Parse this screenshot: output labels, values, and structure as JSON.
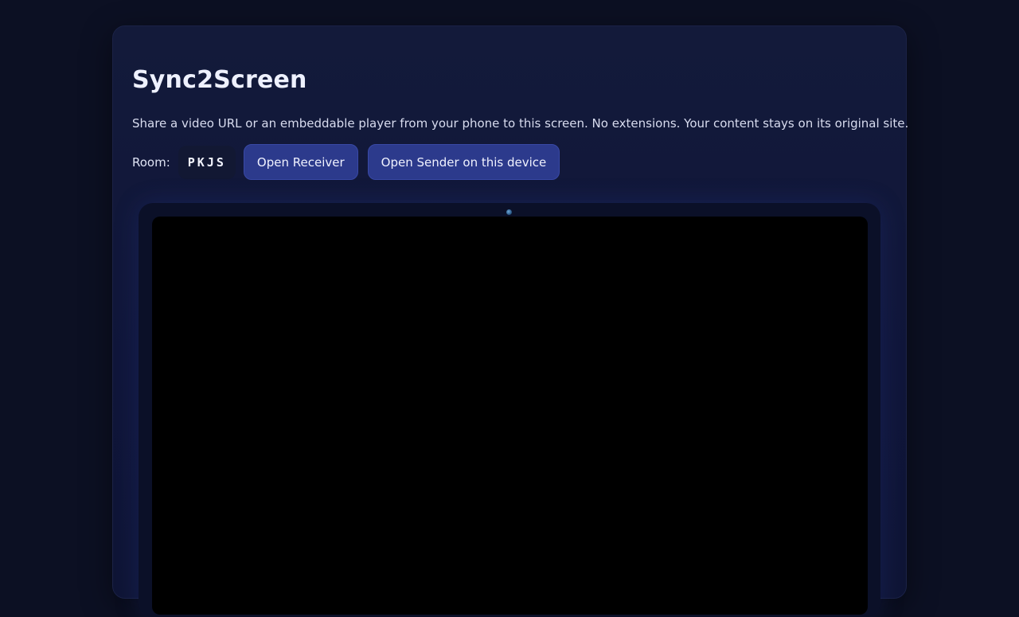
{
  "app": {
    "title": "Sync2Screen",
    "description": "Share a video URL or an embeddable player from your phone to this screen. No extensions. Your content stays on its original site."
  },
  "room": {
    "label": "Room:",
    "code": "PKJS"
  },
  "actions": {
    "open_receiver": "Open Receiver",
    "open_sender": "Open Sender on this device"
  },
  "colors": {
    "background": "#0c1023",
    "card": "#131a3a",
    "button": "#2c3a8c",
    "screen": "#000000"
  }
}
